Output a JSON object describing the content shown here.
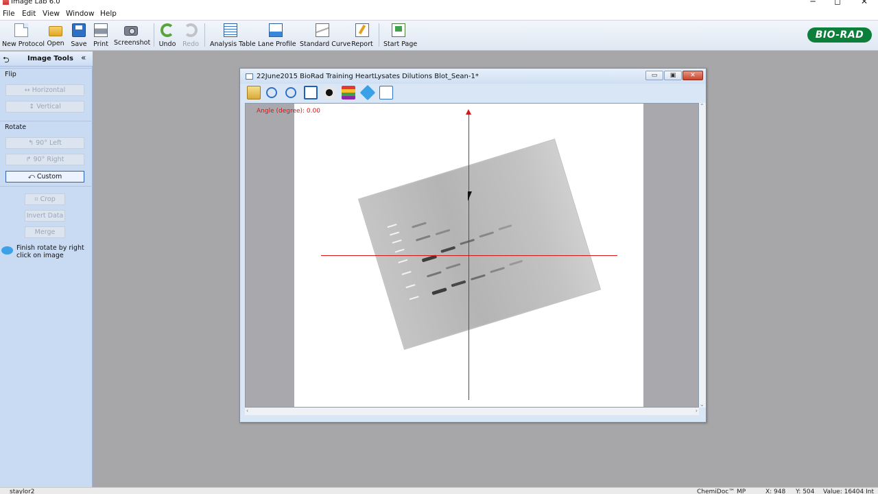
{
  "app": {
    "title": "Image Lab 6.0",
    "window_controls": {
      "minimize": "─",
      "maximize": "◻",
      "close": "✕"
    }
  },
  "menu": [
    "File",
    "Edit",
    "View",
    "Window",
    "Help"
  ],
  "toolbar": {
    "new_protocol": "New Protocol",
    "open": "Open",
    "save": "Save",
    "print": "Print",
    "screenshot": "Screenshot",
    "undo": "Undo",
    "redo": "Redo",
    "analysis_table": "Analysis Table",
    "lane_profile": "Lane Profile",
    "standard_curve": "Standard Curve",
    "report": "Report",
    "start_page": "Start Page",
    "logo": "BIO-RAD"
  },
  "image_tools": {
    "title": "Image Tools",
    "back_glyph": "⮌",
    "collapse_glyph": "«",
    "flip_label": "Flip",
    "horizontal": "↔ Horizontal",
    "vertical": "↕ Vertical",
    "rotate_label": "Rotate",
    "left_90": "↰ 90° Left",
    "right_90": "↱ 90° Right",
    "custom": "⤺ Custom",
    "crop": "⌗ Crop",
    "invert": "Invert Data",
    "merge": "Merge",
    "hint": "Finish rotate by right click on image"
  },
  "image_window": {
    "title": "22June2015 BioRad Training HeartLysates Dilutions Blot_Sean-1*",
    "angle_label": "Angle (degree): 0.00",
    "min_glyph": "▭",
    "max_glyph": "▣",
    "close_glyph": "✕"
  },
  "status": {
    "user": "staylor2",
    "device": "ChemiDoc™ MP",
    "x": "X: 948",
    "y": "Y: 504",
    "value": "Value: 16404 Int"
  },
  "colors": {
    "crosshair": "#d61515",
    "logo_green": "#0c7f3b",
    "panel_blue": "#c9daf3"
  }
}
